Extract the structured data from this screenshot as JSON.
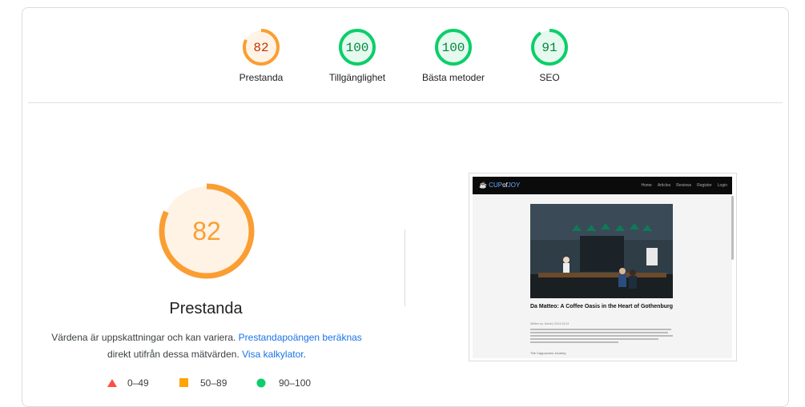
{
  "summary": {
    "gauges": [
      {
        "score": "82",
        "label": "Prestanda",
        "color": "#fa9e33",
        "text_color": "#c33300",
        "fill": "#fff3e6",
        "fraction": 0.82
      },
      {
        "score": "100",
        "label": "Tillgänglighet",
        "color": "#0cce6b",
        "text_color": "#018642",
        "fill": "#e6f9ee",
        "fraction": 1.0
      },
      {
        "score": "100",
        "label": "Bästa metoder",
        "color": "#0cce6b",
        "text_color": "#018642",
        "fill": "#e6f9ee",
        "fraction": 1.0
      },
      {
        "score": "91",
        "label": "SEO",
        "color": "#0cce6b",
        "text_color": "#018642",
        "fill": "#e6f9ee",
        "fraction": 0.91
      }
    ]
  },
  "performance": {
    "score": "82",
    "fraction": 0.82,
    "title": "Prestanda",
    "desc_text1": "Värdena är uppskattningar och kan variera. ",
    "desc_link1": "Prestandapoängen beräknas",
    "desc_text2": "direkt utifrån dessa mätvärden. ",
    "desc_link2": "Visa kalkylator",
    "desc_text3": "."
  },
  "legend": [
    {
      "icon": "triangle-icon",
      "range": "0–49",
      "color": "#ff4e42"
    },
    {
      "icon": "square-icon",
      "range": "50–89",
      "color": "#ffa400"
    },
    {
      "icon": "circle-icon",
      "range": "90–100",
      "color": "#0cce6b"
    }
  ],
  "screenshot": {
    "logo_cup": "CUP",
    "logo_of": "of",
    "logo_joy": "JOY",
    "nav": [
      "Home",
      "Articles",
      "Reviews",
      "Register",
      "Login"
    ],
    "article_title": "Da Matteo: A Coffee Oasis in the Heart of Gothenburg",
    "meta": "Written by: Daniel | 2024-03-04",
    "subheading": "The Cappuccino Journey"
  }
}
